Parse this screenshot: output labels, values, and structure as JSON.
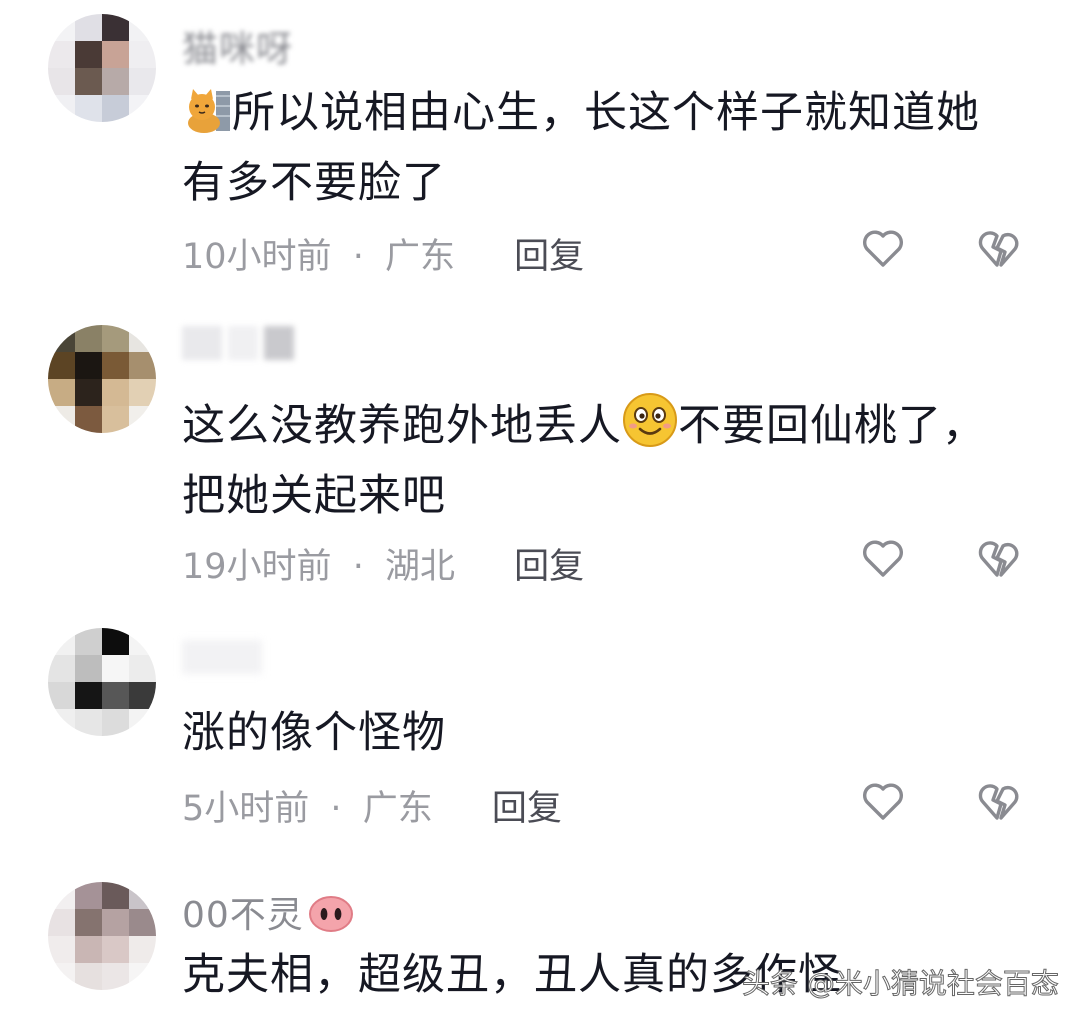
{
  "comments": [
    {
      "username": "猫咪呀",
      "text_before_emoji": "",
      "text_after_emoji": "所以说相由心生，长这个样子就知道她",
      "text_line2": "有多不要脸了",
      "emoji": "cat-face-emoji",
      "time": "10小时前",
      "location": "广东",
      "reply_label": "回复"
    },
    {
      "username": "",
      "text_before_emoji": "这么没教养跑外地丢人",
      "text_after_emoji": "不要回仙桃了，",
      "text_line2": "把她关起来吧",
      "emoji": "smiley-face-emoji",
      "time": "19小时前",
      "location": "湖北",
      "reply_label": "回复"
    },
    {
      "username": "",
      "text": "涨的像个怪物",
      "time": "5小时前",
      "location": "广东",
      "reply_label": "回复"
    },
    {
      "username": "00不灵",
      "username_emoji": "pig-nose-emoji",
      "text": "克夫相，超级丑，丑人真的多作怪"
    }
  ],
  "separator": "·",
  "watermark": "头条 @米小猜说社会百态",
  "icons": {
    "like": "heart-outline-icon",
    "dislike": "broken-heart-icon"
  }
}
